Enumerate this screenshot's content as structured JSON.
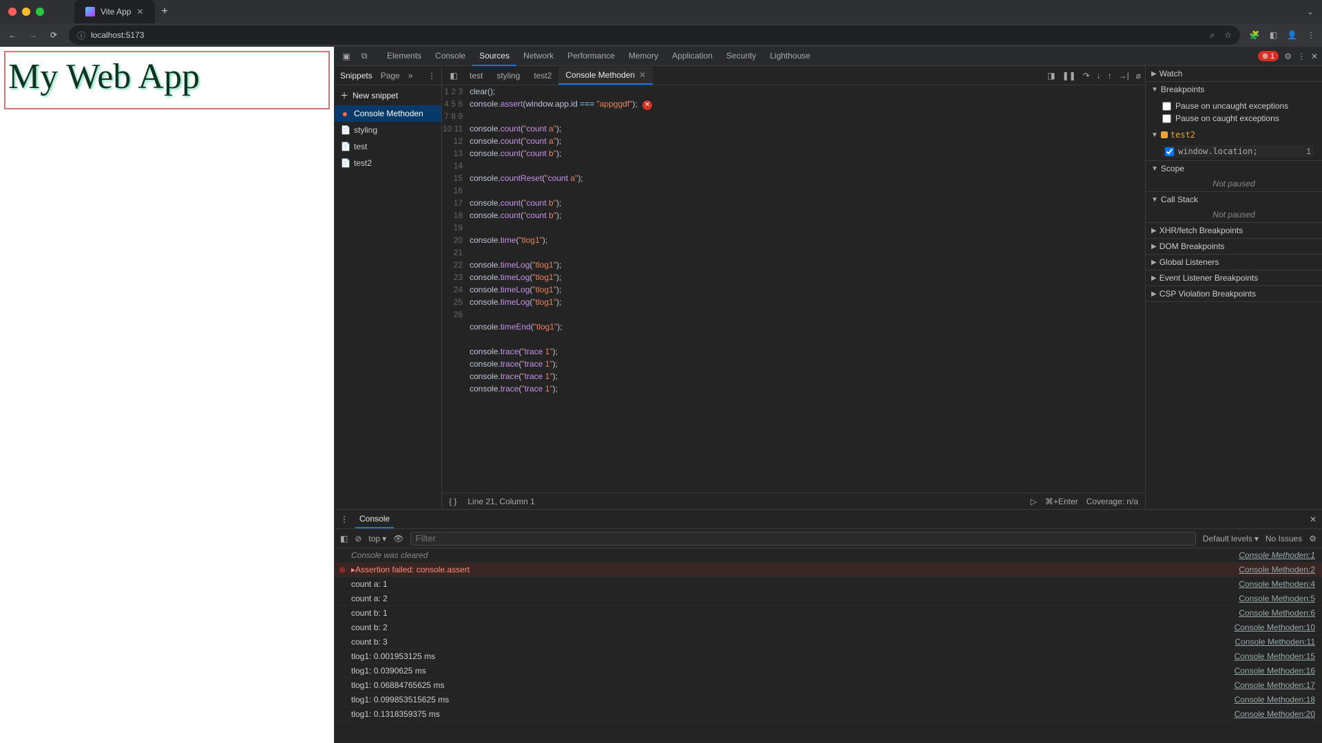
{
  "browser": {
    "tab_title": "Vite App",
    "url_host": "localhost:5173",
    "traffic": [
      "close",
      "minimize",
      "zoom"
    ]
  },
  "page": {
    "heading": "My Web App"
  },
  "devtools": {
    "panels": [
      "Elements",
      "Console",
      "Sources",
      "Network",
      "Performance",
      "Memory",
      "Application",
      "Security",
      "Lighthouse"
    ],
    "active_panel": "Sources",
    "error_count": "1"
  },
  "snippets": {
    "tabs": {
      "snippets": "Snippets",
      "page": "Page"
    },
    "new_label": "New snippet",
    "items": [
      {
        "name": "Console Methoden",
        "selected": true,
        "modified": true
      },
      {
        "name": "styling"
      },
      {
        "name": "test"
      },
      {
        "name": "test2"
      }
    ]
  },
  "editor": {
    "tabs": [
      "test",
      "styling",
      "test2",
      "Console Methoden"
    ],
    "active_tab": "Console Methoden",
    "run_hint": "⌘+Enter",
    "coverage": "Coverage: n/a",
    "status": "Line 21, Column 1",
    "code_lines": [
      "clear();",
      "console.assert(window.app.id === \"appggdf\");",
      "",
      "console.count(\"count a\");",
      "console.count(\"count a\");",
      "console.count(\"count b\");",
      "",
      "console.countReset(\"count a\");",
      "",
      "console.count(\"count b\");",
      "console.count(\"count b\");",
      "",
      "console.time(\"tlog1\");",
      "",
      "console.timeLog(\"tlog1\");",
      "console.timeLog(\"tlog1\");",
      "console.timeLog(\"tlog1\");",
      "console.timeLog(\"tlog1\");",
      "",
      "console.timeEnd(\"tlog1\");",
      "",
      "console.trace(\"trace 1\");",
      "console.trace(\"trace 1\");",
      "console.trace(\"trace 1\");",
      "console.trace(\"trace 1\");",
      ""
    ]
  },
  "debugger": {
    "controls": [
      "pause",
      "step-over",
      "step-into",
      "step-out",
      "step",
      "deactivate-breakpoints"
    ],
    "sections": {
      "watch": "Watch",
      "breakpoints": "Breakpoints",
      "scope": "Scope",
      "callstack": "Call Stack",
      "xhr": "XHR/fetch Breakpoints",
      "dom": "DOM Breakpoints",
      "global": "Global Listeners",
      "event": "Event Listener Breakpoints",
      "csp": "CSP Violation Breakpoints"
    },
    "pause_uncaught": "Pause on uncaught exceptions",
    "pause_caught": "Pause on caught exceptions",
    "bp_file": "test2",
    "bp_code": "window.location;",
    "bp_line": "1",
    "not_paused": "Not paused"
  },
  "console": {
    "drawer_tab": "Console",
    "context": "top",
    "filter_placeholder": "Filter",
    "levels": "Default levels",
    "issues": "No Issues",
    "logs": [
      {
        "type": "info",
        "msg": "Console was cleared",
        "src": "Console Methoden:1"
      },
      {
        "type": "error",
        "msg": "▸Assertion failed: console.assert",
        "src": "Console Methoden:2"
      },
      {
        "type": "log",
        "msg": "count a: 1",
        "src": "Console Methoden:4"
      },
      {
        "type": "log",
        "msg": "count a: 2",
        "src": "Console Methoden:5"
      },
      {
        "type": "log",
        "msg": "count b: 1",
        "src": "Console Methoden:6"
      },
      {
        "type": "log",
        "msg": "count b: 2",
        "src": "Console Methoden:10"
      },
      {
        "type": "log",
        "msg": "count b: 3",
        "src": "Console Methoden:11"
      },
      {
        "type": "log",
        "msg": "tlog1: 0.001953125 ms",
        "src": "Console Methoden:15"
      },
      {
        "type": "log",
        "msg": "tlog1: 0.0390625 ms",
        "src": "Console Methoden:16"
      },
      {
        "type": "log",
        "msg": "tlog1: 0.06884765625 ms",
        "src": "Console Methoden:17"
      },
      {
        "type": "log",
        "msg": "tlog1: 0.099853515625 ms",
        "src": "Console Methoden:18"
      },
      {
        "type": "log",
        "msg": "tlog1: 0.1318359375 ms",
        "src": "Console Methoden:20"
      }
    ]
  }
}
